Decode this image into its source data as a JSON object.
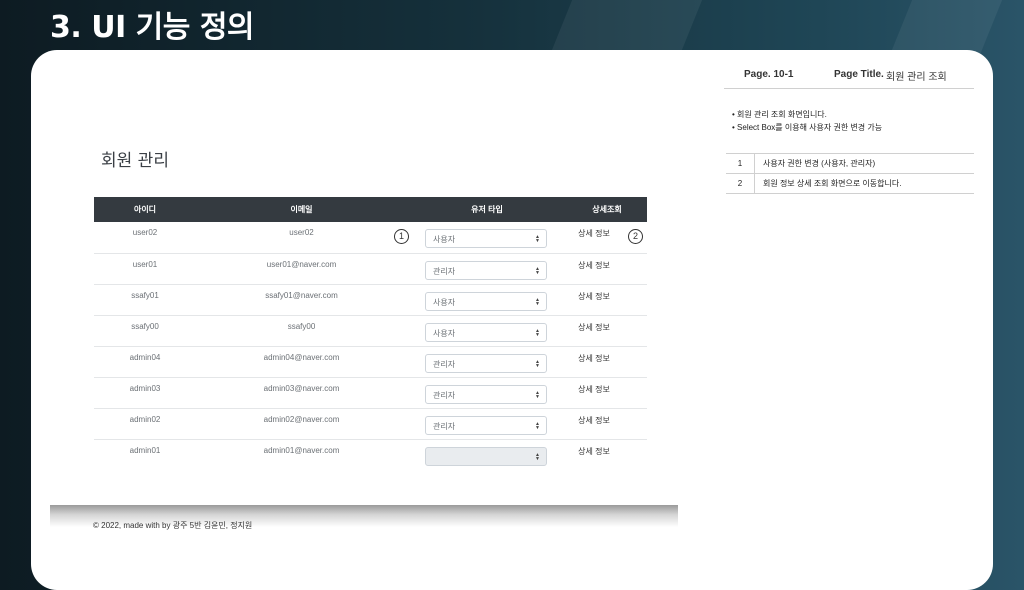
{
  "slide_title": "3. UI 기능 정의",
  "mock": {
    "heading": "회원 관리",
    "columns": [
      "아이디",
      "이메일",
      "유저 타입",
      "상세조회"
    ],
    "rows": [
      {
        "id": "user02",
        "email": "user02",
        "type": "사용자",
        "detail": "상세 정보"
      },
      {
        "id": "user01",
        "email": "user01@naver.com",
        "type": "관리자",
        "detail": "상세 정보"
      },
      {
        "id": "ssafy01",
        "email": "ssafy01@naver.com",
        "type": "사용자",
        "detail": "상세 정보"
      },
      {
        "id": "ssafy00",
        "email": "ssafy00",
        "type": "사용자",
        "detail": "상세 정보"
      },
      {
        "id": "admin04",
        "email": "admin04@naver.com",
        "type": "관리자",
        "detail": "상세 정보"
      },
      {
        "id": "admin03",
        "email": "admin03@naver.com",
        "type": "관리자",
        "detail": "상세 정보"
      },
      {
        "id": "admin02",
        "email": "admin02@naver.com",
        "type": "관리자",
        "detail": "상세 정보"
      },
      {
        "id": "admin01",
        "email": "admin01@naver.com",
        "type": "",
        "detail": "상세 정보"
      }
    ],
    "callouts": [
      "1",
      "2"
    ],
    "select_arrow_icon": "updown-arrow-icon",
    "footer": "© 2022, made with by 광주 5반 김윤민, 정지원"
  },
  "page_info": {
    "page_no": "Page. 10-1",
    "page_title_label": "Page Title.",
    "page_title": "회원 관리 조회"
  },
  "description": [
    "회원 관리 조회 화면입니다.",
    "Select Box를 이용해 사용자 권한 변경 가능"
  ],
  "notes": [
    {
      "num": "1",
      "text": "사용자 권한 변경 (사용자, 관리자)"
    },
    {
      "num": "2",
      "text": "회원 정보 상세 조회 화면으로 이동합니다."
    }
  ],
  "colors": {
    "table_header": "#343a40",
    "background_dark": "#0d1b22",
    "background_light": "#2a5468"
  }
}
